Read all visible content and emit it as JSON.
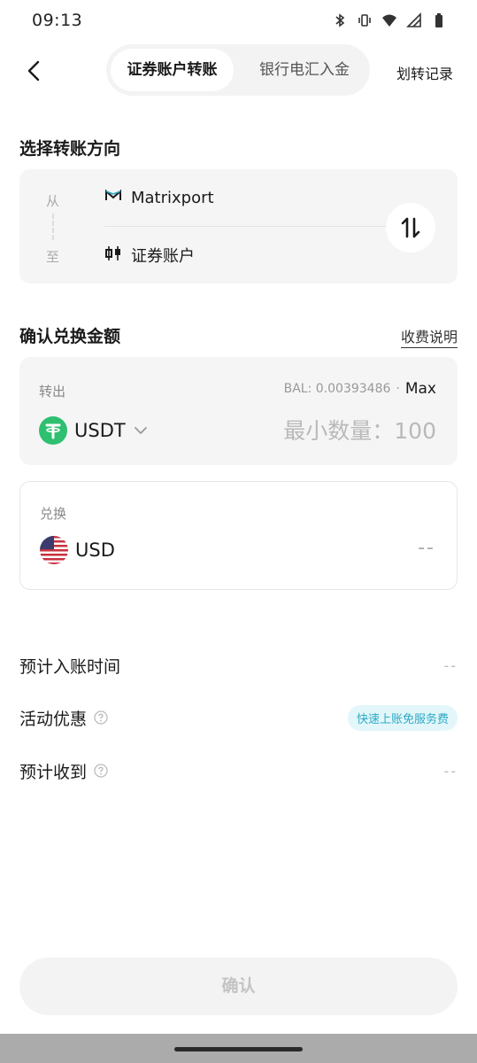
{
  "status_bar": {
    "time": "09:13",
    "icons": [
      "bluetooth-icon",
      "vibrate-icon",
      "wifi-icon",
      "signal-icon",
      "battery-icon"
    ]
  },
  "header": {
    "tabs": [
      {
        "label": "证券账户转账",
        "active": true
      },
      {
        "label": "银行电汇入金",
        "active": false
      }
    ],
    "record_link": "划转记录"
  },
  "direction": {
    "title": "选择转账方向",
    "from_label": "从",
    "to_label": "至",
    "from_account": "Matrixport",
    "to_account": "证券账户"
  },
  "amount": {
    "title": "确认兑换金额",
    "fee_link": "收费说明",
    "out": {
      "label": "转出",
      "balance": "BAL: 0.00393486",
      "max_label": "Max",
      "token": "USDT",
      "placeholder": "最小数量：100",
      "token_color": "#2FBF71"
    },
    "in": {
      "label": "兑换",
      "token": "USD",
      "value": "--"
    }
  },
  "info": {
    "eta_label": "预计入账时间",
    "eta_value": "--",
    "promo_label": "活动优惠",
    "promo_badge": "快速上账免服务费",
    "receive_label": "预计收到",
    "receive_value": "--"
  },
  "confirm_button": "确认",
  "colors": {
    "accent": "#2da9c4",
    "card_bg": "#f5f5f5"
  }
}
